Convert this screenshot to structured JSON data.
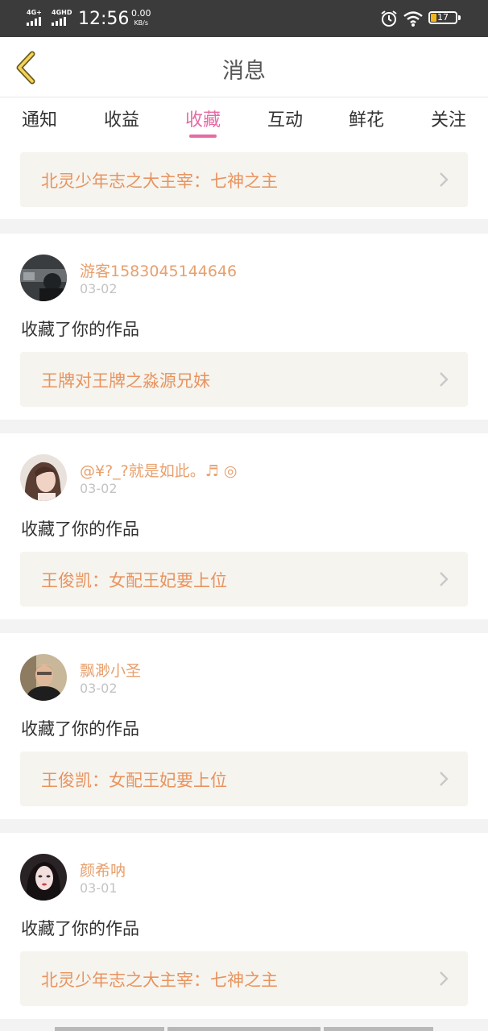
{
  "status_bar": {
    "sim1": "4G+",
    "sim2": "4GHD",
    "time": "12:56",
    "speed_value": "0.00",
    "speed_unit": "KB/s",
    "battery": "17",
    "icons": [
      "signal-icon",
      "alarm-icon",
      "wifi-icon",
      "battery-icon"
    ]
  },
  "header": {
    "title": "消息",
    "back_icon": "chevron-left-icon"
  },
  "tabs": [
    {
      "label": "通知",
      "active": false
    },
    {
      "label": "收益",
      "active": false
    },
    {
      "label": "收藏",
      "active": true
    },
    {
      "label": "互动",
      "active": false
    },
    {
      "label": "鲜花",
      "active": false
    },
    {
      "label": "关注",
      "active": false
    }
  ],
  "colors": {
    "accent_pink": "#e76aa3",
    "username_orange": "#e7a06e",
    "work_title_orange": "#e9935f",
    "work_bg": "#f5f4ee"
  },
  "top_work": {
    "title": "北灵少年志之大主宰：七神之主"
  },
  "items": [
    {
      "username": "游客1583045144646",
      "date": "03-02",
      "action": "收藏了你的作品",
      "work": "王牌对王牌之淼源兄妹"
    },
    {
      "username": "@¥?_?就是如此。♬ ◎",
      "date": "03-02",
      "action": "收藏了你的作品",
      "work": "王俊凯：女配王妃要上位"
    },
    {
      "username": "飘渺小圣",
      "date": "03-02",
      "action": "收藏了你的作品",
      "work": "王俊凯：女配王妃要上位"
    },
    {
      "username": "颜希呐",
      "date": "03-01",
      "action": "收藏了你的作品",
      "work": "北灵少年志之大主宰：七神之主"
    }
  ]
}
